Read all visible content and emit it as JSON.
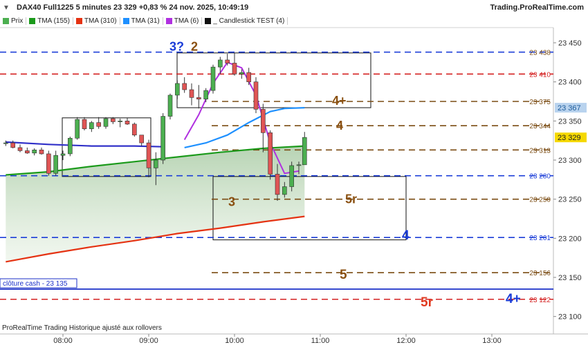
{
  "header": {
    "title": "DAX40 Full1225 5 minutes 23 329 +0,83 % 24 nov. 2025, 10:49:19",
    "brand": "Trading.ProRealTime.com"
  },
  "legend": [
    {
      "label": "Prix",
      "color": "#4caf50"
    },
    {
      "label": "TMA (155)",
      "color": "#1b9a1b"
    },
    {
      "label": "TMA (310)",
      "color": "#e53212"
    },
    {
      "label": "TMA (31)",
      "color": "#1e90ff"
    },
    {
      "label": "TMA (6)",
      "color": "#b030e0"
    },
    {
      "label": "_ Candlestick TEST (4)",
      "color": "#111111"
    }
  ],
  "footer": {
    "source": "ProRealTime Trading  Historique ajusté aux rollovers"
  },
  "chart_data": {
    "type": "candlestick",
    "title": "DAX40 Full1225 5 minutes",
    "x_ticks": [
      "08:00",
      "09:00",
      "10:00",
      "11:00",
      "12:00",
      "13:00"
    ],
    "y_ticks": [
      23100,
      23150,
      23200,
      23250,
      23300,
      23350,
      23400,
      23450
    ],
    "ylim": [
      23085,
      23468
    ],
    "last_price": 23329,
    "tma31_last": 23367,
    "close_cash": {
      "label": "clôture cash -  23 135",
      "value": 23135
    },
    "candles": [
      {
        "t": "07:20",
        "o": 23321,
        "h": 23325,
        "l": 23318,
        "c": 23322
      },
      {
        "t": "07:25",
        "o": 23322,
        "h": 23325,
        "l": 23315,
        "c": 23316
      },
      {
        "t": "07:30",
        "o": 23316,
        "h": 23320,
        "l": 23310,
        "c": 23312
      },
      {
        "t": "07:35",
        "o": 23312,
        "h": 23316,
        "l": 23308,
        "c": 23309
      },
      {
        "t": "07:40",
        "o": 23309,
        "h": 23315,
        "l": 23306,
        "c": 23313
      },
      {
        "t": "07:45",
        "o": 23313,
        "h": 23316,
        "l": 23307,
        "c": 23308
      },
      {
        "t": "07:50",
        "o": 23308,
        "h": 23312,
        "l": 23280,
        "c": 23283
      },
      {
        "t": "07:55",
        "o": 23283,
        "h": 23312,
        "l": 23280,
        "c": 23306
      },
      {
        "t": "08:00",
        "o": 23306,
        "h": 23312,
        "l": 23300,
        "c": 23308
      },
      {
        "t": "08:05",
        "o": 23308,
        "h": 23330,
        "l": 23305,
        "c": 23328
      },
      {
        "t": "08:10",
        "o": 23328,
        "h": 23355,
        "l": 23326,
        "c": 23352
      },
      {
        "t": "08:15",
        "o": 23352,
        "h": 23355,
        "l": 23338,
        "c": 23340
      },
      {
        "t": "08:20",
        "o": 23340,
        "h": 23350,
        "l": 23336,
        "c": 23348
      },
      {
        "t": "08:25",
        "o": 23348,
        "h": 23355,
        "l": 23340,
        "c": 23343
      },
      {
        "t": "08:30",
        "o": 23343,
        "h": 23355,
        "l": 23340,
        "c": 23353
      },
      {
        "t": "08:35",
        "o": 23353,
        "h": 23355,
        "l": 23346,
        "c": 23349
      },
      {
        "t": "08:40",
        "o": 23349,
        "h": 23353,
        "l": 23342,
        "c": 23350
      },
      {
        "t": "08:45",
        "o": 23350,
        "h": 23354,
        "l": 23345,
        "c": 23346
      },
      {
        "t": "08:50",
        "o": 23346,
        "h": 23348,
        "l": 23330,
        "c": 23332
      },
      {
        "t": "08:55",
        "o": 23332,
        "h": 23328,
        "l": 23318,
        "c": 23322
      },
      {
        "t": "09:00",
        "o": 23322,
        "h": 23326,
        "l": 23278,
        "c": 23290
      },
      {
        "t": "09:05",
        "o": 23290,
        "h": 23310,
        "l": 23268,
        "c": 23300
      },
      {
        "t": "09:10",
        "o": 23300,
        "h": 23360,
        "l": 23295,
        "c": 23356
      },
      {
        "t": "09:15",
        "o": 23356,
        "h": 23385,
        "l": 23352,
        "c": 23383
      },
      {
        "t": "09:20",
        "o": 23383,
        "h": 23402,
        "l": 23378,
        "c": 23398
      },
      {
        "t": "09:25",
        "o": 23398,
        "h": 23406,
        "l": 23386,
        "c": 23390
      },
      {
        "t": "09:30",
        "o": 23390,
        "h": 23398,
        "l": 23370,
        "c": 23380
      },
      {
        "t": "09:35",
        "o": 23380,
        "h": 23396,
        "l": 23366,
        "c": 23378
      },
      {
        "t": "09:40",
        "o": 23378,
        "h": 23392,
        "l": 23374,
        "c": 23389
      },
      {
        "t": "09:45",
        "o": 23389,
        "h": 23422,
        "l": 23385,
        "c": 23419
      },
      {
        "t": "09:50",
        "o": 23419,
        "h": 23432,
        "l": 23410,
        "c": 23428
      },
      {
        "t": "09:55",
        "o": 23428,
        "h": 23436,
        "l": 23421,
        "c": 23424
      },
      {
        "t": "10:00",
        "o": 23424,
        "h": 23437,
        "l": 23408,
        "c": 23410
      },
      {
        "t": "10:05",
        "o": 23410,
        "h": 23416,
        "l": 23404,
        "c": 23412
      },
      {
        "t": "10:10",
        "o": 23412,
        "h": 23418,
        "l": 23396,
        "c": 23400
      },
      {
        "t": "10:15",
        "o": 23400,
        "h": 23406,
        "l": 23360,
        "c": 23365
      },
      {
        "t": "10:20",
        "o": 23365,
        "h": 23372,
        "l": 23310,
        "c": 23335
      },
      {
        "t": "10:25",
        "o": 23335,
        "h": 23338,
        "l": 23275,
        "c": 23282
      },
      {
        "t": "10:30",
        "o": 23282,
        "h": 23295,
        "l": 23248,
        "c": 23256
      },
      {
        "t": "10:35",
        "o": 23256,
        "h": 23272,
        "l": 23252,
        "c": 23266
      },
      {
        "t": "10:40",
        "o": 23266,
        "h": 23298,
        "l": 23260,
        "c": 23293
      },
      {
        "t": "10:45",
        "o": 23293,
        "h": 23298,
        "l": 23282,
        "c": 23294
      },
      {
        "t": "10:49",
        "o": 23294,
        "h": 23336,
        "l": 23294,
        "c": 23329
      }
    ],
    "moving_averages": [
      {
        "name": "TMA (6)",
        "color": "#b030e0",
        "points": [
          [
            "09:25",
            23326
          ],
          [
            "09:35",
            23358
          ],
          [
            "09:45",
            23398
          ],
          [
            "09:55",
            23425
          ],
          [
            "10:05",
            23418
          ],
          [
            "10:15",
            23383
          ],
          [
            "10:25",
            23322
          ],
          [
            "10:35",
            23283
          ],
          [
            "10:45",
            23286
          ]
        ]
      },
      {
        "name": "TMA (31)",
        "color": "#1e90ff",
        "points": [
          [
            "09:25",
            23316
          ],
          [
            "09:40",
            23322
          ],
          [
            "09:55",
            23332
          ],
          [
            "10:10",
            23348
          ],
          [
            "10:25",
            23362
          ],
          [
            "10:35",
            23366
          ],
          [
            "10:49",
            23367
          ]
        ]
      },
      {
        "name": "TMA (155)",
        "color": "#1b9a1b",
        "points": [
          [
            "07:20",
            23281
          ],
          [
            "07:50",
            23285
          ],
          [
            "08:20",
            23292
          ],
          [
            "08:50",
            23298
          ],
          [
            "09:20",
            23304
          ],
          [
            "09:50",
            23310
          ],
          [
            "10:20",
            23315
          ],
          [
            "10:49",
            23318
          ]
        ]
      },
      {
        "name": "TMA (310)",
        "color": "#e53212",
        "points": [
          [
            "07:20",
            23170
          ],
          [
            "07:50",
            23180
          ],
          [
            "08:20",
            23189
          ],
          [
            "08:50",
            23197
          ],
          [
            "09:20",
            23206
          ],
          [
            "09:50",
            23213
          ],
          [
            "10:20",
            23221
          ],
          [
            "10:49",
            23228
          ]
        ]
      },
      {
        "name": "Candlestick TEST",
        "color": "#3030c8",
        "points": [
          [
            "07:20",
            23323
          ],
          [
            "07:50",
            23320
          ],
          [
            "08:20",
            23318
          ],
          [
            "08:50",
            23318
          ],
          [
            "09:10",
            23317
          ]
        ]
      }
    ],
    "levels": [
      {
        "value": 23438,
        "label": "23 438",
        "color": "#1a3cd8",
        "style": "dashed",
        "text_color": "#7a4b12"
      },
      {
        "value": 23410,
        "label": "23 410",
        "color": "#d42020",
        "style": "dashed",
        "text_color": "#d42020"
      },
      {
        "value": 23375,
        "label": "23 375",
        "color": "#7a4b12",
        "style": "dashed",
        "text_color": "#7a4b12"
      },
      {
        "value": 23344,
        "label": "23 344",
        "color": "#7a4b12",
        "style": "dashed",
        "text_color": "#7a4b12"
      },
      {
        "value": 23313,
        "label": "23 313",
        "color": "#7a4b12",
        "style": "dashed",
        "text_color": "#7a4b12"
      },
      {
        "value": 23280,
        "label": "23 280",
        "color": "#1a3cd8",
        "style": "dashed",
        "text_color": "#1a3cd8"
      },
      {
        "value": 23250,
        "label": "23 250",
        "color": "#7a4b12",
        "style": "dashed",
        "text_color": "#7a4b12"
      },
      {
        "value": 23201,
        "label": "23 201",
        "color": "#1a3cd8",
        "style": "dashed",
        "text_color": "#1a3cd8"
      },
      {
        "value": 23156,
        "label": "23 156",
        "color": "#7a4b12",
        "style": "dashed",
        "text_color": "#7a4b12"
      },
      {
        "value": 23122,
        "label": "23 122",
        "color": "#d42020",
        "style": "dashed",
        "text_color": "#d42020"
      }
    ],
    "annotations": [
      {
        "text": "3?",
        "color": "#1a3cd8"
      },
      {
        "text": "2",
        "color": "#8a5010"
      },
      {
        "text": "4+",
        "color": "#8a5010"
      },
      {
        "text": "4",
        "color": "#8a5010"
      },
      {
        "text": "3",
        "color": "#8a5010"
      },
      {
        "text": "5r",
        "color": "#8a5010"
      },
      {
        "text": "4",
        "color": "#1a3cd8"
      },
      {
        "text": "5",
        "color": "#8a5010"
      },
      {
        "text": "5r",
        "color": "#e03a20"
      },
      {
        "text": "4+",
        "color": "#1a3cd8"
      }
    ],
    "last_badges": [
      {
        "value": 23367,
        "label": "23 367",
        "color": "#b9d3ee",
        "text_color": "#1a5a9a"
      },
      {
        "value": 23329,
        "label": "23 329",
        "color": "#f5d800",
        "text_color": "#222222"
      }
    ]
  }
}
